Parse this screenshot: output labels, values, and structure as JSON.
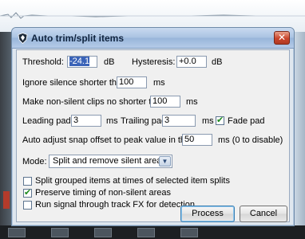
{
  "dialog": {
    "title": "Auto trim/split items",
    "threshold_label": "Threshold:",
    "threshold_value": "-24.1",
    "threshold_unit": "dB",
    "hysteresis_label": "Hysteresis:",
    "hysteresis_value": "+0.0",
    "hysteresis_unit": "dB",
    "ignore_label": "Ignore silence shorter than:",
    "ignore_value": "100",
    "ignore_unit": "ms",
    "min_clip_label": "Make non-silent clips no shorter than:",
    "min_clip_value": "100",
    "min_clip_unit": "ms",
    "leading_label": "Leading pad:",
    "leading_value": "3",
    "leading_unit": "ms",
    "trailing_label": "Trailing pad:",
    "trailing_value": "3",
    "trailing_unit": "ms",
    "fade_pad_label": "Fade pad",
    "fade_pad_checked": true,
    "snap_label": "Auto adjust snap offset to peak value in the first",
    "snap_value": "50",
    "snap_unit": "ms (0 to disable)",
    "mode_label": "Mode:",
    "mode_value": "Split and remove silent areas",
    "options": [
      {
        "label": "Split grouped items at times of selected item splits",
        "checked": false
      },
      {
        "label": "Preserve timing of non-silent areas",
        "checked": true
      },
      {
        "label": "Run signal through track FX for detection",
        "checked": false
      }
    ],
    "process_label": "Process",
    "cancel_label": "Cancel",
    "close_glyph": "✕"
  },
  "colors": {
    "check_mark": "#1e8a1e",
    "close_button": "#c9452c",
    "selection": "#3a63b8"
  }
}
